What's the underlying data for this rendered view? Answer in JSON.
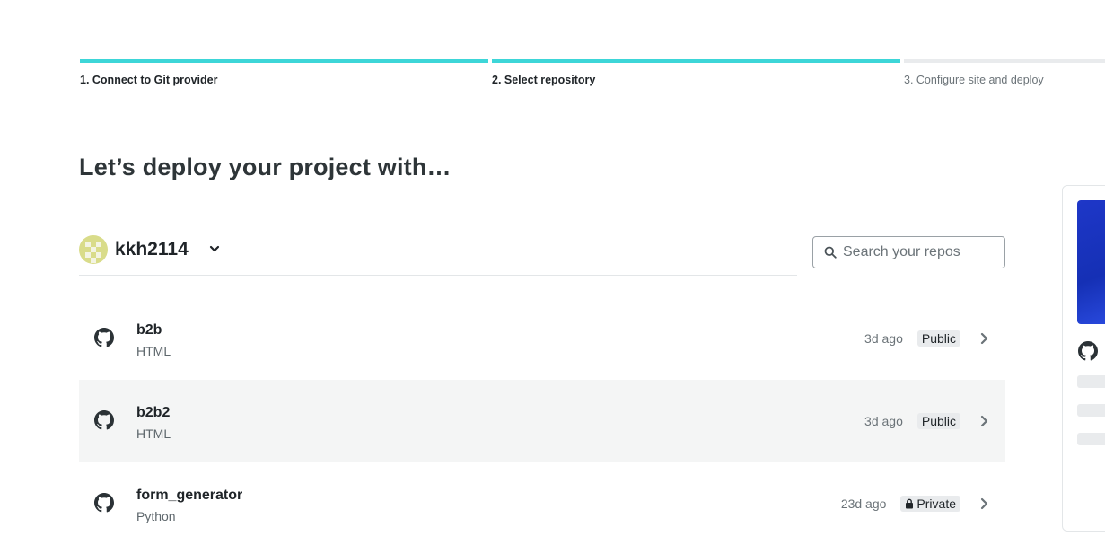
{
  "stepper": {
    "steps": [
      {
        "label": "1. Connect to Git provider",
        "state": "done"
      },
      {
        "label": "2. Select repository",
        "state": "done"
      },
      {
        "label": "3. Configure site and deploy",
        "state": "pending"
      }
    ],
    "accent_color": "#3dd6d8"
  },
  "page_title": "Let’s deploy your project with…",
  "account": {
    "name": "kkh2114",
    "icon": "chevron-down-icon"
  },
  "search": {
    "placeholder": "Search your repos",
    "value": ""
  },
  "repos": [
    {
      "name": "b2b",
      "language": "HTML",
      "updated": "3d ago",
      "visibility": "Public",
      "private": false
    },
    {
      "name": "b2b2",
      "language": "HTML",
      "updated": "3d ago",
      "visibility": "Public",
      "private": false
    },
    {
      "name": "form_generator",
      "language": "Python",
      "updated": "23d ago",
      "visibility": "Private",
      "private": true
    }
  ]
}
